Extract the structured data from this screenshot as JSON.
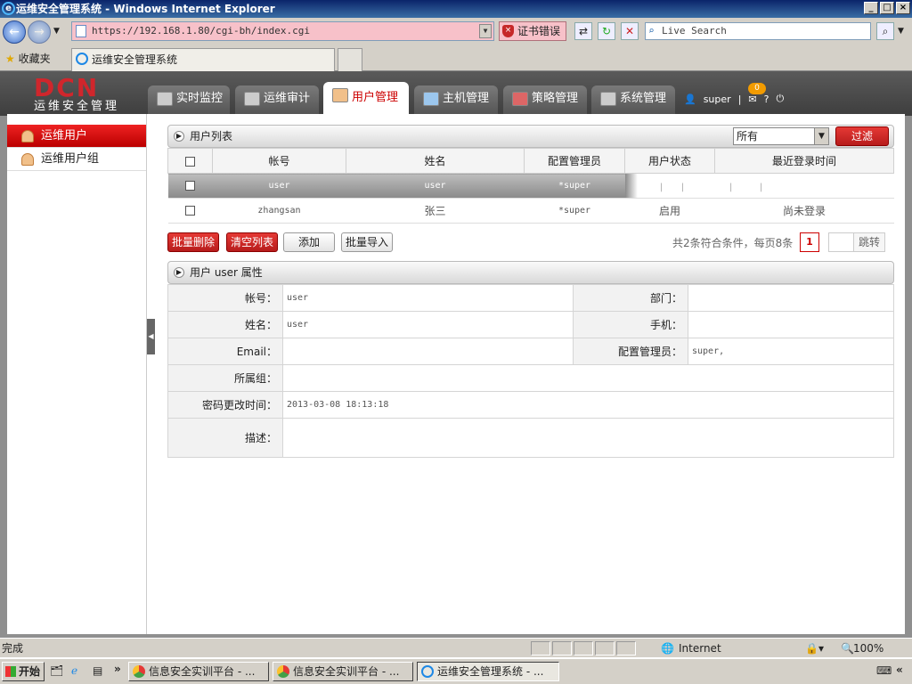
{
  "browser": {
    "title": "运维安全管理系统 - Windows Internet Explorer",
    "url": "https://192.168.1.80/cgi-bh/index.cgi",
    "cert_error": "证书错误",
    "search_placeholder": "Live Search",
    "favorites": "收藏夹",
    "tab_title": "运维安全管理系统"
  },
  "app": {
    "logo": "DCN",
    "logo_sub": "运维安全管理",
    "tabs": [
      "实时监控",
      "运维审计",
      "用户管理",
      "主机管理",
      "策略管理",
      "系统管理"
    ],
    "active_tab": "用户管理",
    "user": "super",
    "message_count": "0",
    "help": "?",
    "accent_color": "#cc1f1f"
  },
  "sidebar": {
    "items": [
      {
        "label": "运维用户",
        "active": true
      },
      {
        "label": "运维用户组",
        "active": false
      }
    ]
  },
  "user_list": {
    "title": "用户列表",
    "filter_value": "所有",
    "filter_button": "过滤",
    "columns": [
      "帐号",
      "姓名",
      "配置管理员",
      "用户状态",
      "最近登录时间"
    ],
    "rows": [
      {
        "account": "user",
        "name": "user",
        "admin": "*super",
        "status": "",
        "last_login": "",
        "actions": [
          "编辑",
          "组",
          "访问授权",
          "停用",
          "删除"
        ]
      },
      {
        "account": "zhangsan",
        "name": "张三",
        "admin": "*super",
        "status": "启用",
        "last_login": "尚未登录"
      }
    ],
    "buttons": {
      "batch_delete": "批量删除",
      "clear_list": "清空列表",
      "add": "添加",
      "batch_import": "批量导入"
    },
    "pager_text": "共2条符合条件，每页8条",
    "current_page": "1",
    "jump": "跳转"
  },
  "props": {
    "title": "用户 user 属性",
    "account_label": "帐号：",
    "account": "user",
    "dept_label": "部门：",
    "dept": "",
    "name_label": "姓名：",
    "name": "user",
    "phone_label": "手机：",
    "phone": "",
    "email_label": "Email：",
    "email": "",
    "admin_label": "配置管理员：",
    "admin": "super,",
    "group_label": "所属组：",
    "group": "",
    "pwd_label": "密码更改时间：",
    "pwd_time": "2013-03-08 18:13:18",
    "desc_label": "描述：",
    "desc": ""
  },
  "statusbar": {
    "text": "完成",
    "zone": "Internet",
    "zoom": "100%"
  },
  "taskbar": {
    "start": "开始",
    "buttons": [
      "信息安全实训平台 - ...",
      "信息安全实训平台 - ...",
      "运维安全管理系统 - ..."
    ]
  }
}
